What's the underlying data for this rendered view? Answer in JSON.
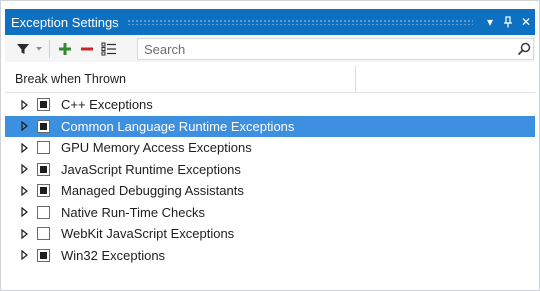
{
  "window": {
    "title": "Exception Settings",
    "dropdown_glyph": "▾",
    "pin_glyph": "ᛘ",
    "close_glyph": "✕"
  },
  "toolbar": {
    "filter_icon": "filter-icon",
    "add_icon": "add-icon",
    "remove_icon": "remove-icon",
    "restore_icon": "restore-defaults-icon",
    "search_placeholder": "Search",
    "search_value": ""
  },
  "columns": {
    "name": "Break when Thrown"
  },
  "tree": {
    "items": [
      {
        "label": "C++ Exceptions",
        "checked": true,
        "selected": false
      },
      {
        "label": "Common Language Runtime Exceptions",
        "checked": true,
        "selected": true
      },
      {
        "label": "GPU Memory Access Exceptions",
        "checked": false,
        "selected": false
      },
      {
        "label": "JavaScript Runtime Exceptions",
        "checked": true,
        "selected": false
      },
      {
        "label": "Managed Debugging Assistants",
        "checked": true,
        "selected": false
      },
      {
        "label": "Native Run-Time Checks",
        "checked": false,
        "selected": false
      },
      {
        "label": "WebKit JavaScript Exceptions",
        "checked": false,
        "selected": false
      },
      {
        "label": "Win32 Exceptions",
        "checked": true,
        "selected": false
      }
    ]
  },
  "colors": {
    "titlebar": "#0e70c0",
    "selection": "#3d8fe0",
    "add_green": "#2e8b2e",
    "remove_red": "#c62828"
  }
}
